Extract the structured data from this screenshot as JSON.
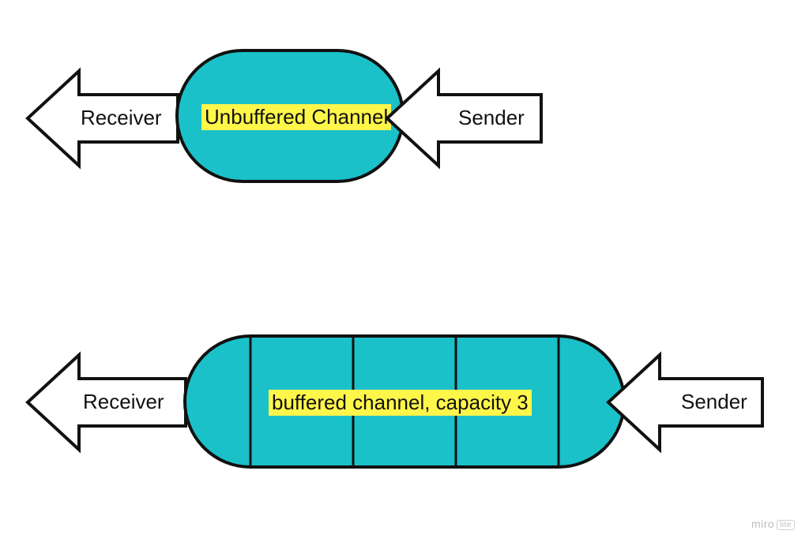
{
  "colors": {
    "channel_fill": "#1bc1c9",
    "stroke": "#111111",
    "highlight": "#fff64a"
  },
  "unbuffered": {
    "receiver_label": "Receiver",
    "sender_label": "Sender",
    "channel_label": "Unbuffered Channel"
  },
  "buffered": {
    "receiver_label": "Receiver",
    "sender_label": "Sender",
    "channel_label": "buffered channel, capacity 3",
    "capacity": 3
  },
  "watermark": {
    "brand": "miro",
    "tier": "lite"
  }
}
